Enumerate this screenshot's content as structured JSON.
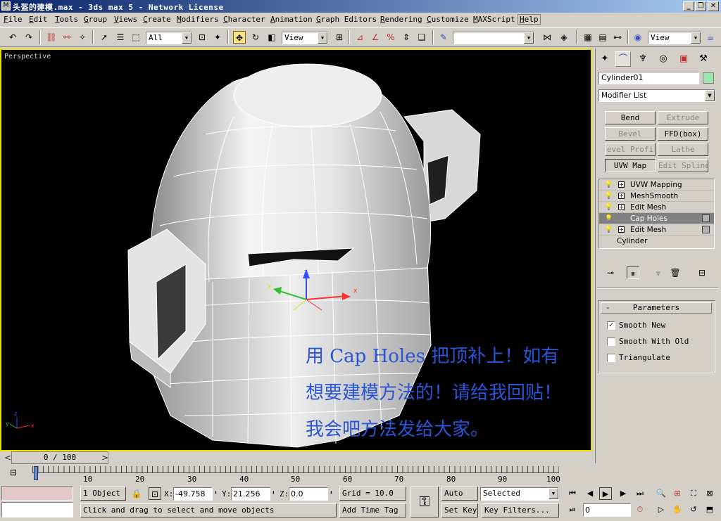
{
  "window": {
    "title": "头盔的建模.max - 3ds max 5 - Network License",
    "app_icon": "3ds-max-icon",
    "controls": {
      "minimize": "_",
      "restore": "❐",
      "close": "✕"
    }
  },
  "menu": [
    "File",
    "Edit",
    "Tools",
    "Group",
    "Views",
    "Create",
    "Modifiers",
    "Character",
    "Animation",
    "Graph Editors",
    "Rendering",
    "Customize",
    "MAXScript",
    "Help"
  ],
  "toolbar": {
    "selection_filter": "All",
    "reference_coord": "View",
    "named_selection": "",
    "view_combo": "View"
  },
  "viewport": {
    "label": "Perspective",
    "annotation": [
      "用 Cap Holes 把顶补上！如有",
      "想要建模方法的！请给我回贴！",
      "我会吧方法发给大家。"
    ],
    "gizmo": {
      "x": "x",
      "y": "y",
      "z": "z"
    }
  },
  "command_panel": {
    "object_name": "Cylinder01",
    "object_color": "#9ee6b0",
    "modifier_list": "Modifier List",
    "buttons": [
      {
        "label": "Bend",
        "enabled": true
      },
      {
        "label": "Extrude",
        "enabled": false
      },
      {
        "label": "Bevel",
        "enabled": false
      },
      {
        "label": "FFD(box)",
        "enabled": true
      },
      {
        "label": "evel Profi",
        "enabled": false
      },
      {
        "label": "Lathe",
        "enabled": false
      },
      {
        "label": "UVW Map",
        "enabled": true
      },
      {
        "label": "Edit Spline",
        "enabled": false
      }
    ],
    "stack": [
      {
        "label": "UVW Mapping",
        "plus": true,
        "selected": false,
        "box": false
      },
      {
        "label": "MeshSmooth",
        "plus": true,
        "selected": false,
        "box": false
      },
      {
        "label": "Edit Mesh",
        "plus": true,
        "selected": false,
        "box": false
      },
      {
        "label": "Cap Holes",
        "plus": false,
        "selected": true,
        "box": true
      },
      {
        "label": "Edit Mesh",
        "plus": true,
        "selected": false,
        "box": true
      },
      {
        "label": "Cylinder",
        "plus": false,
        "selected": false,
        "box": false
      }
    ],
    "parameters": {
      "title": "Parameters",
      "toggle": "-",
      "options": [
        {
          "label": "Smooth New",
          "checked": true
        },
        {
          "label": "Smooth With Old",
          "checked": false
        },
        {
          "label": "Triangulate",
          "checked": false
        }
      ]
    }
  },
  "timeline": {
    "slider": "0 / 100",
    "ticks": [
      "0",
      "10",
      "20",
      "30",
      "40",
      "50",
      "60",
      "70",
      "80",
      "90",
      "100"
    ]
  },
  "status": {
    "objects": "1 Object",
    "x_label": "X:",
    "x_value": "-49.758",
    "y_label": "Y:",
    "y_value": "21.256",
    "z_label": "Z:",
    "z_value": "0.0",
    "grid": "Grid = 10.0",
    "prompt": "Click and drag to select and move objects",
    "add_time_tag": "Add Time Tag",
    "auto_key": "Auto Key",
    "set_key": "Set Key",
    "selected": "Selected",
    "key_filters": "Key Filters...",
    "frame": "0"
  }
}
